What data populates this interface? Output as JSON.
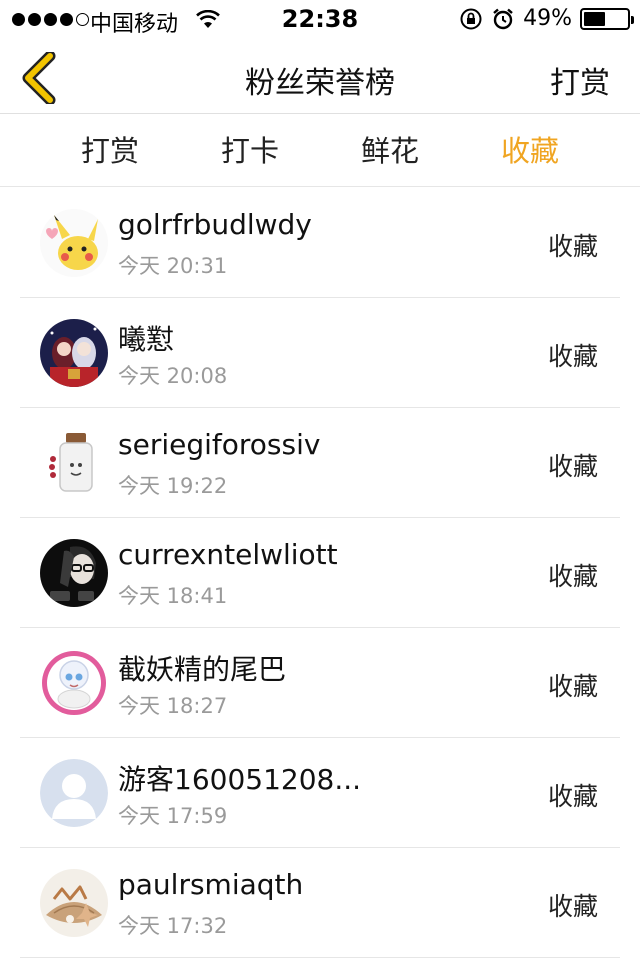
{
  "status_bar": {
    "carrier": "中国移动",
    "time": "22:38",
    "battery": "49%",
    "battery_level": 0.49
  },
  "nav": {
    "title": "粉丝荣誉榜",
    "right_action": "打赏",
    "back_icon": "chevron-left-icon",
    "back_color": "#f2c400"
  },
  "tabs": [
    {
      "label": "打赏",
      "active": false
    },
    {
      "label": "打卡",
      "active": false
    },
    {
      "label": "鲜花",
      "active": false
    },
    {
      "label": "收藏",
      "active": true
    }
  ],
  "accent_color": "#f0a522",
  "rows": [
    {
      "name": "golrfrbudlwdy",
      "time": "今天 20:31",
      "action": "收藏"
    },
    {
      "name": "曦懟",
      "time": "今天 20:08",
      "action": "收藏"
    },
    {
      "name": "seriegiforossiv",
      "time": "今天 19:22",
      "action": "收藏"
    },
    {
      "name": "currexntelwliott",
      "time": "今天 18:41",
      "action": "收藏"
    },
    {
      "name": "截妖精的尾巴",
      "time": "今天 18:27",
      "action": "收藏"
    },
    {
      "name": "游客160051208...",
      "time": "今天 17:59",
      "action": "收藏"
    },
    {
      "name": "paulrsmiaqth",
      "time": "今天 17:32",
      "action": "收藏"
    }
  ]
}
